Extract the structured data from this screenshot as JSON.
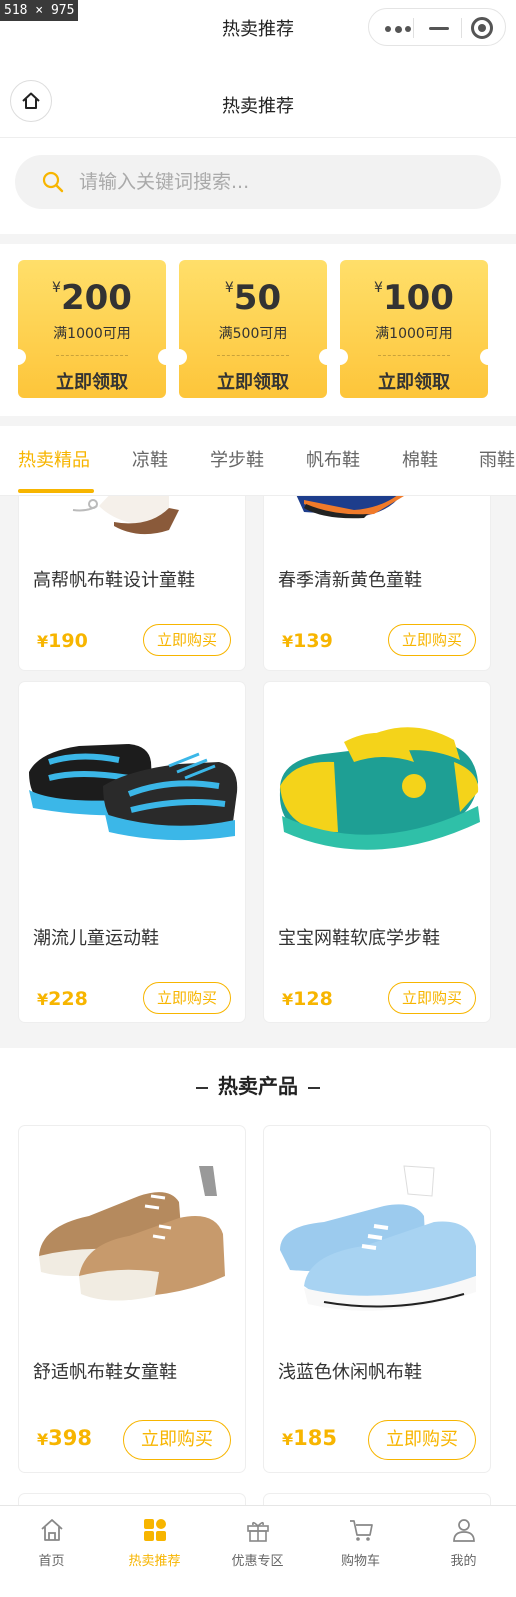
{
  "window": {
    "size_tag": "518 × 975",
    "title": "热卖推荐"
  },
  "nav": {
    "title": "热卖推荐"
  },
  "search": {
    "placeholder": "请输入关键词搜索..."
  },
  "coupons": [
    {
      "yen": "¥",
      "amount": "200",
      "condition": "满1000可用",
      "action": "立即领取"
    },
    {
      "yen": "¥",
      "amount": "50",
      "condition": "满500可用",
      "action": "立即领取"
    },
    {
      "yen": "¥",
      "amount": "100",
      "condition": "满1000可用",
      "action": "立即领取"
    }
  ],
  "tabs": [
    {
      "label": "热卖精品",
      "active": true
    },
    {
      "label": "凉鞋"
    },
    {
      "label": "学步鞋"
    },
    {
      "label": "帆布鞋"
    },
    {
      "label": "棉鞋"
    },
    {
      "label": "雨鞋"
    }
  ],
  "products": [
    {
      "name": "高帮帆布鞋设计童鞋",
      "yen": "¥",
      "price": "190",
      "action": "立即购买"
    },
    {
      "name": "春季清新黄色童鞋",
      "yen": "¥",
      "price": "139",
      "action": "立即购买"
    },
    {
      "name": "潮流儿童运动鞋",
      "yen": "¥",
      "price": "228",
      "action": "立即购买"
    },
    {
      "name": "宝宝网鞋软底学步鞋",
      "yen": "¥",
      "price": "128",
      "action": "立即购买"
    }
  ],
  "hot": {
    "title": "热卖产品",
    "items": [
      {
        "name": "舒适帆布鞋女童鞋",
        "yen": "¥",
        "price": "398",
        "action": "立即购买"
      },
      {
        "name": "浅蓝色休闲帆布鞋",
        "yen": "¥",
        "price": "185",
        "action": "立即购买"
      }
    ]
  },
  "tabbar": [
    {
      "label": "首页",
      "icon": "home-icon"
    },
    {
      "label": "热卖推荐",
      "icon": "grid-icon",
      "active": true
    },
    {
      "label": "优惠专区",
      "icon": "gift-icon"
    },
    {
      "label": "购物车",
      "icon": "cart-icon"
    },
    {
      "label": "我的",
      "icon": "user-icon"
    }
  ],
  "colors": {
    "accent": "#f7b500",
    "coupon_top": "#ffdf6a",
    "coupon_bottom": "#fdc53a"
  }
}
